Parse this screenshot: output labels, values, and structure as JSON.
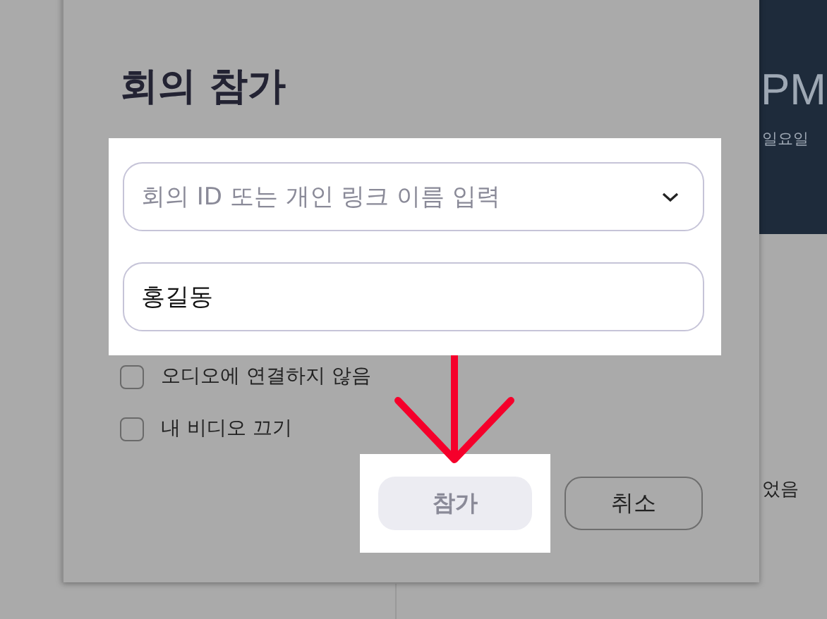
{
  "background": {
    "clock": "PM",
    "day": "일요일",
    "note": "었음"
  },
  "dialog": {
    "title": "회의 참가",
    "meeting_field": {
      "placeholder": "회의 ID 또는 개인 링크 이름 입력"
    },
    "name_field": {
      "value": "홍길동"
    },
    "options": [
      {
        "label": "오디오에 연결하지 않음",
        "checked": false
      },
      {
        "label": "내 비디오 끄기",
        "checked": false
      }
    ],
    "buttons": [
      {
        "label": "참가",
        "kind": "primary",
        "disabled": true
      },
      {
        "label": "취소",
        "kind": "secondary",
        "disabled": false
      }
    ]
  }
}
